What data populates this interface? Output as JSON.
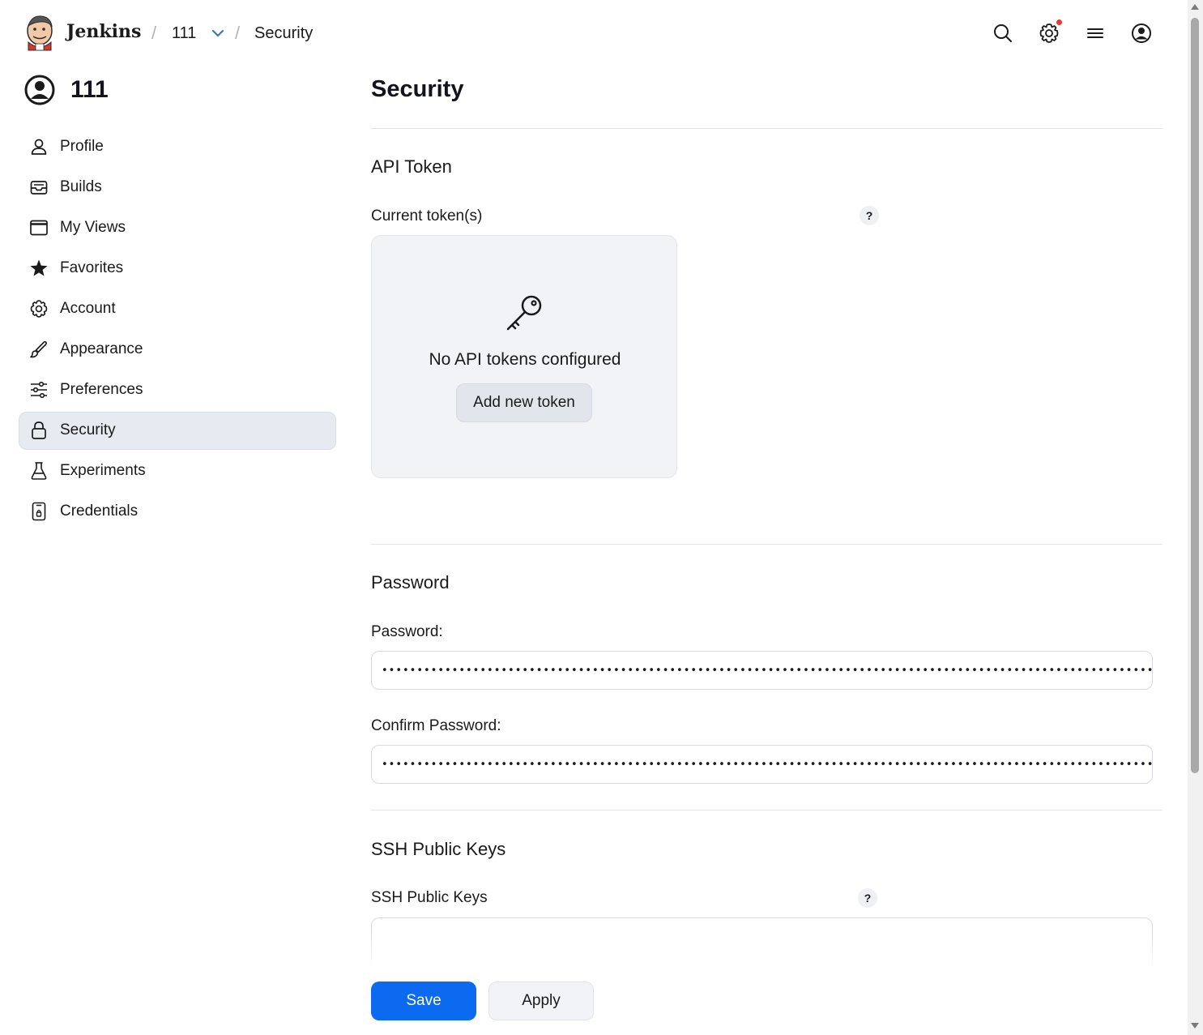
{
  "header": {
    "brand": "Jenkins",
    "breadcrumb": [
      "111",
      "Security"
    ],
    "separator": "/",
    "icons": [
      "search-icon",
      "gear-icon",
      "menu-icon",
      "user-circle-icon"
    ],
    "notification_color": "#e53935"
  },
  "sidebar": {
    "user_name": "111",
    "items": [
      {
        "label": "Profile",
        "icon": "person-icon"
      },
      {
        "label": "Builds",
        "icon": "inbox-icon"
      },
      {
        "label": "My Views",
        "icon": "window-icon"
      },
      {
        "label": "Favorites",
        "icon": "star-icon"
      },
      {
        "label": "Account",
        "icon": "gear-icon"
      },
      {
        "label": "Appearance",
        "icon": "brush-icon"
      },
      {
        "label": "Preferences",
        "icon": "sliders-icon"
      },
      {
        "label": "Security",
        "icon": "lock-icon",
        "active": true
      },
      {
        "label": "Experiments",
        "icon": "flask-icon"
      },
      {
        "label": "Credentials",
        "icon": "credentials-icon"
      }
    ]
  },
  "main": {
    "title": "Security",
    "api_token": {
      "section_title": "API Token",
      "label": "Current token(s)",
      "help": "?",
      "empty_message": "No API tokens configured",
      "add_button": "Add new token"
    },
    "password": {
      "section_title": "Password",
      "password_label": "Password:",
      "password_value": "••••••••••••••••••••••••••••••••••••••••••••••••••••••••••••••••••••••••••••••••••••••••••••••••••••••••••••••",
      "confirm_label": "Confirm Password:",
      "confirm_value": "••••••••••••••••••••••••••••••••••••••••••••••••••••••••••••••••••••••••••••••••••••••••••••••••••••••••••••••"
    },
    "ssh": {
      "section_title": "SSH Public Keys",
      "label": "SSH Public Keys",
      "help": "?"
    },
    "buttons": {
      "save": "Save",
      "apply": "Apply"
    }
  },
  "colors": {
    "primary": "#0b6aef",
    "active_nav": "#e7eaf1",
    "token_box": "#f1f3f6"
  }
}
